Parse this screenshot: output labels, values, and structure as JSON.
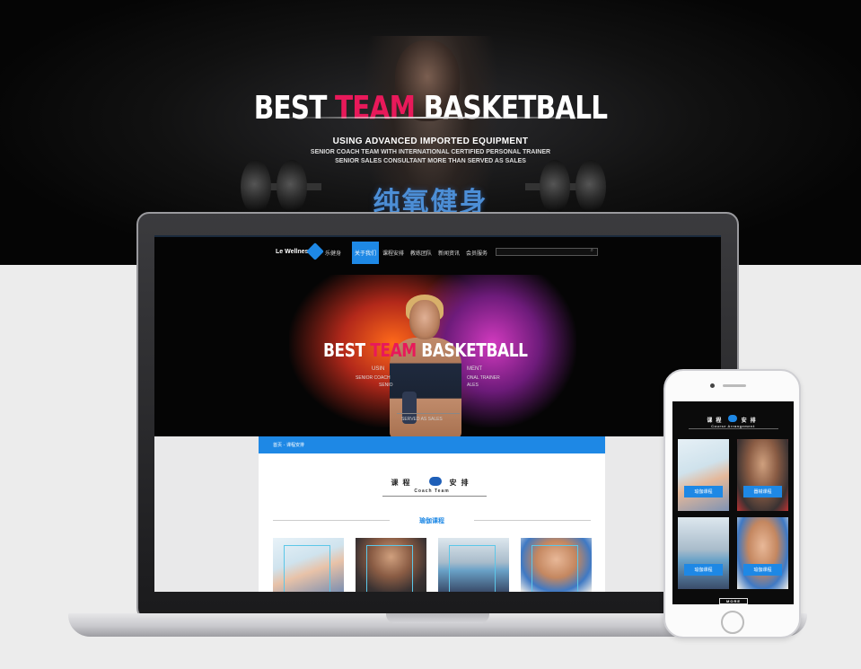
{
  "hero": {
    "title_part1": "BEST ",
    "title_highlight": "TEAM",
    "title_part2": " BASKETBALL",
    "subtitle1": "USING ADVANCED IMPORTED EQUIPMENT",
    "subtitle2": "SENIOR COACH TEAM WITH INTERNATIONAL CERTIFIED PERSONAL TRAINER",
    "subtitle3": "SENIOR SALES CONSULTANT MORE THAN SERVED AS SALES",
    "cn_title": "纯氧健身",
    "accent_color": "#e8195a"
  },
  "site": {
    "logo_text": "Le Wellness",
    "logo_cn": "乐健身",
    "nav": [
      {
        "label": "关于我们",
        "active": true
      },
      {
        "label": "课程安排",
        "active": false
      },
      {
        "label": "教练团队",
        "active": false
      },
      {
        "label": "新闻资讯",
        "active": false
      },
      {
        "label": "会员服务",
        "active": false
      }
    ],
    "search_icon": "magnifier-icon",
    "banner": {
      "title_part1": "BEST ",
      "title_highlight": "TEAM",
      "title_part2": " BASKETBALL",
      "sub_left": "USIN",
      "sub_right": "MENT",
      "line2_left": "SENIOR COACH",
      "line2_right": "ONAL TRAINER",
      "line3_left": "SENIO",
      "line3_right": "ALES",
      "button_text": "SERVED AS SALES"
    },
    "breadcrumb": "首页 - 课程安排",
    "section_title_left": "课程",
    "section_title_right": "安排",
    "section_subtitle": "Coach Team",
    "category": "瑜伽课程",
    "brand_color": "#1e88e5"
  },
  "mobile": {
    "title_left": "课程",
    "title_right": "安排",
    "subtitle": "Course Arrangement",
    "cards": [
      {
        "label": "瑜伽课程"
      },
      {
        "label": "器械课程"
      },
      {
        "label": "瑜伽课程"
      },
      {
        "label": "瑜伽课程"
      }
    ],
    "more": "MORE"
  }
}
